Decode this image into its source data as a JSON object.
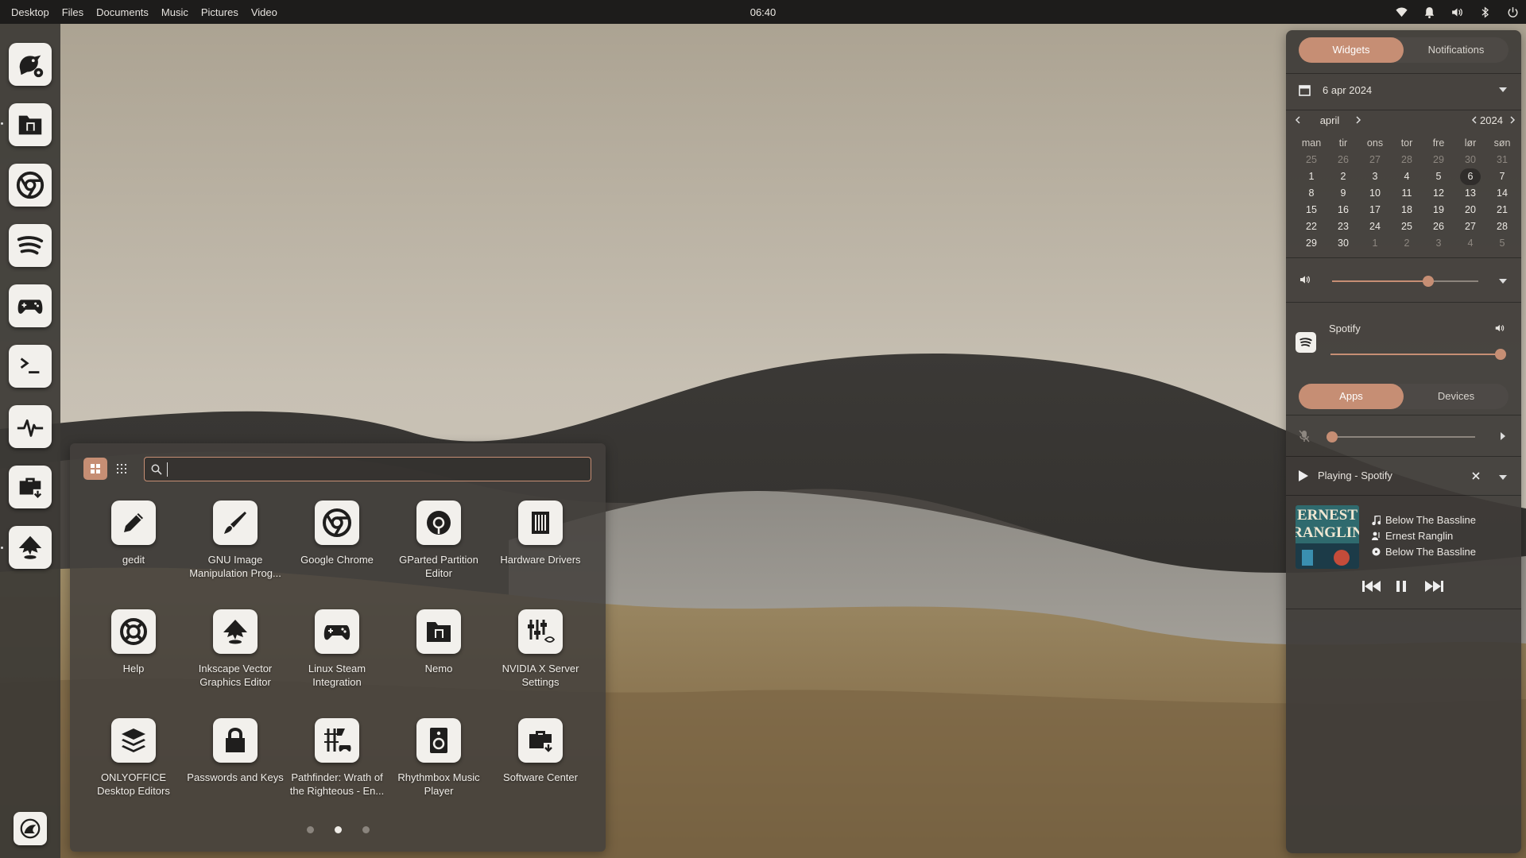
{
  "topbar": {
    "menu": [
      "Desktop",
      "Files",
      "Documents",
      "Music",
      "Pictures",
      "Video"
    ],
    "clock": "06:40",
    "tray_icons": [
      "wifi-icon",
      "bell-icon",
      "volume-icon",
      "bluetooth-icon",
      "power-icon"
    ]
  },
  "dock": {
    "items": [
      {
        "name": "budgie-settings-icon"
      },
      {
        "name": "files-icon"
      },
      {
        "name": "chrome-icon"
      },
      {
        "name": "spotify-icon"
      },
      {
        "name": "gamepad-icon"
      },
      {
        "name": "terminal-icon"
      },
      {
        "name": "system-monitor-icon"
      },
      {
        "name": "software-center-icon"
      },
      {
        "name": "inkscape-icon"
      }
    ],
    "menu_icon": "budgie-menu-icon"
  },
  "launcher": {
    "search": {
      "value": "",
      "placeholder": ""
    },
    "apps": [
      {
        "label": "gedit",
        "icon": "pencil-icon"
      },
      {
        "label": "GNU Image Manipulation Prog...",
        "icon": "brush-icon"
      },
      {
        "label": "Google Chrome",
        "icon": "chrome-icon"
      },
      {
        "label": "GParted Partition Editor",
        "icon": "disk-icon"
      },
      {
        "label": "Hardware Drivers",
        "icon": "chip-icon"
      },
      {
        "label": "Help",
        "icon": "lifebuoy-icon"
      },
      {
        "label": "Inkscape Vector Graphics Editor",
        "icon": "inkscape-icon"
      },
      {
        "label": "Linux Steam Integration",
        "icon": "gamepad-icon"
      },
      {
        "label": "Nemo",
        "icon": "files-icon"
      },
      {
        "label": "NVIDIA X Server Settings",
        "icon": "mixer-icon"
      },
      {
        "label": "ONLYOFFICE Desktop Editors",
        "icon": "layers-icon"
      },
      {
        "label": "Passwords and Keys",
        "icon": "lock-icon"
      },
      {
        "label": "Pathfinder: Wrath of the Righteous - En...",
        "icon": "pathfinder-icon"
      },
      {
        "label": "Rhythmbox Music Player",
        "icon": "speaker-icon"
      },
      {
        "label": "Software Center",
        "icon": "software-center-icon"
      }
    ],
    "pages": 3,
    "current_page": 2
  },
  "panel": {
    "tabs": {
      "widgets": "Widgets",
      "notifications": "Notifications"
    },
    "date_label": "6 apr 2024",
    "calendar": {
      "month": "april",
      "year": "2024",
      "weekdays": [
        "man",
        "tir",
        "ons",
        "tor",
        "fre",
        "lør",
        "søn"
      ],
      "weeks": [
        [
          "25",
          "26",
          "27",
          "28",
          "29",
          "30",
          "31"
        ],
        [
          "1",
          "2",
          "3",
          "4",
          "5",
          "6",
          "7"
        ],
        [
          "8",
          "9",
          "10",
          "11",
          "12",
          "13",
          "14"
        ],
        [
          "15",
          "16",
          "17",
          "18",
          "19",
          "20",
          "21"
        ],
        [
          "22",
          "23",
          "24",
          "25",
          "26",
          "27",
          "28"
        ],
        [
          "29",
          "30",
          "1",
          "2",
          "3",
          "4",
          "5"
        ]
      ],
      "today": "6"
    },
    "volume": {
      "level": 0.66
    },
    "spotify": {
      "label": "Spotify",
      "level": 1.0
    },
    "audio_tabs": {
      "apps": "Apps",
      "devices": "Devices"
    },
    "mic": {
      "level": 0.0
    },
    "media": {
      "title": "Playing - Spotify",
      "track": "Below The Bassline",
      "artist": "Ernest Ranglin",
      "album": "Below The Bassline",
      "album_art_text": [
        "ERNEST",
        "RANGLIN"
      ]
    }
  },
  "colors": {
    "accent": "#c68e74",
    "panel_bg": "#3e3b38",
    "topbar_bg": "#1d1c1b"
  }
}
